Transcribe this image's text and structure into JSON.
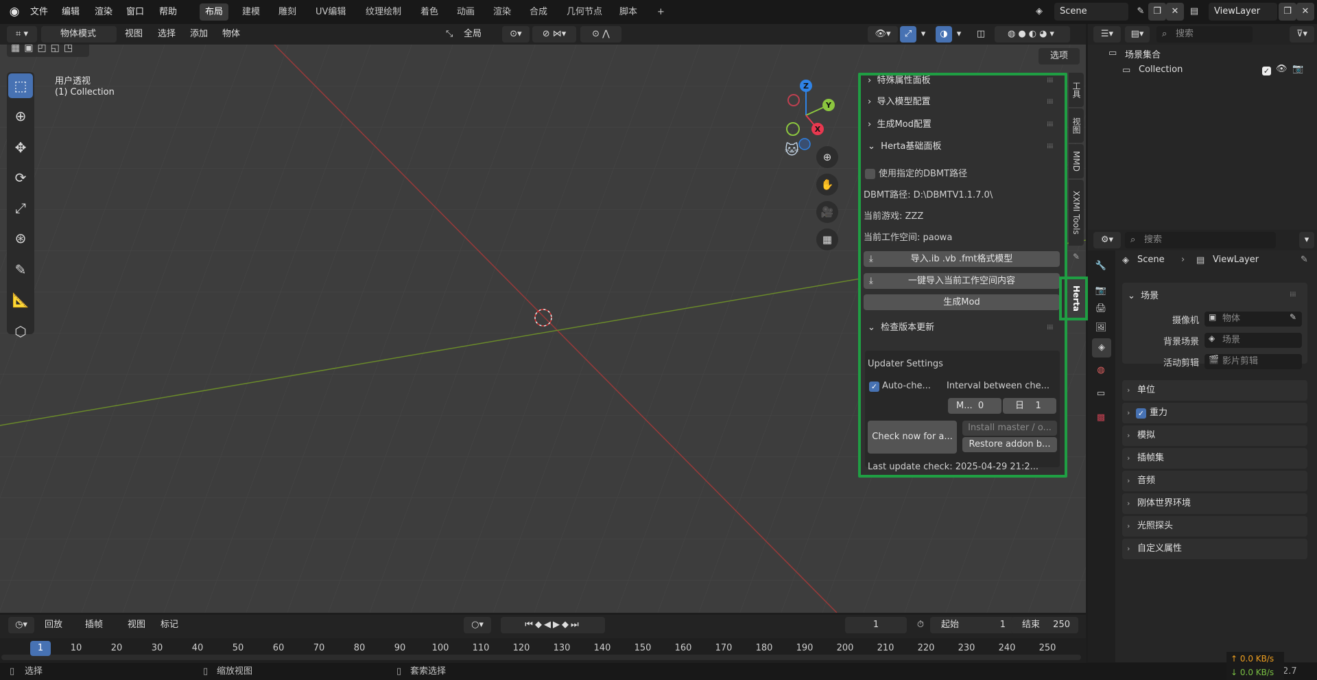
{
  "topbar": {
    "menus": [
      "文件",
      "编辑",
      "渲染",
      "窗口",
      "帮助"
    ],
    "workspaces": [
      "布局",
      "建模",
      "雕刻",
      "UV编辑",
      "纹理绘制",
      "着色",
      "动画",
      "渲染",
      "合成",
      "几何节点",
      "脚本"
    ],
    "add_workspace": "+",
    "scene_name": "Scene",
    "view_layer": "ViewLayer"
  },
  "viewport_header": {
    "mode": "物体模式",
    "menus": [
      "视图",
      "选择",
      "添加",
      "物体"
    ],
    "transform_orientation": "全局",
    "options": "选项"
  },
  "viewport": {
    "view_name": "用户透视",
    "collection_label": "(1) Collection",
    "gizmo": {
      "x": "X",
      "y": "Y",
      "z": "Z"
    }
  },
  "sidebar_tabs": [
    "工具",
    "视图",
    "MMD",
    "XXMI Tools",
    "Herta"
  ],
  "herta_panel": {
    "sections": [
      "特殊属性面板",
      "导入模型配置",
      "生成Mod配置",
      "Herta基础面板"
    ],
    "use_dbmt_label": "使用指定的DBMT路径",
    "dbmt_path": "DBMT路径: D:\\DBMTV1.1.7.0\\",
    "current_game": "当前游戏: ZZZ",
    "workspace": "当前工作空间: paowa",
    "import_button": "导入.ib .vb .fmt格式模型",
    "import_all_button": "一键导入当前工作空间内容",
    "generate_button": "生成Mod",
    "update_section": "检查版本更新",
    "updater_title": "Updater Settings",
    "auto_check": "Auto-che...",
    "interval_label": "Interval between che...",
    "months_label": "M...",
    "months_value": "0",
    "days_label": "日",
    "days_value": "1",
    "check_now": "Check now for a...",
    "install_master": "Install master / o...",
    "restore_addon": "Restore addon b...",
    "last_check": "Last update check: 2025-04-29 21:2..."
  },
  "outliner": {
    "search_placeholder": "搜索",
    "scene_collection": "场景集合",
    "collection": "Collection"
  },
  "properties": {
    "search_placeholder": "搜索",
    "breadcrumb_scene": "Scene",
    "breadcrumb_layer": "ViewLayer",
    "scene_section": "场景",
    "camera_label": "摄像机",
    "camera_value": "物体",
    "background_label": "背景场景",
    "background_value": "场景",
    "clip_label": "活动剪辑",
    "clip_value": "影片剪辑",
    "categories": [
      "单位",
      "重力",
      "模拟",
      "插帧集",
      "音频",
      "刚体世界环境",
      "光照探头",
      "自定义属性"
    ]
  },
  "timeline": {
    "menus": [
      "回放",
      "插帧",
      "视图",
      "标记"
    ],
    "current_frame": "1",
    "start_label": "起始",
    "start_value": "1",
    "end_label": "结束",
    "end_value": "250",
    "ticks": [
      "1",
      "10",
      "20",
      "30",
      "40",
      "50",
      "60",
      "70",
      "80",
      "90",
      "100",
      "110",
      "120",
      "130",
      "140",
      "150",
      "160",
      "170",
      "180",
      "190",
      "200",
      "210",
      "220",
      "230",
      "240",
      "250"
    ]
  },
  "statusbar": {
    "select": "选择",
    "zoom": "缩放视图",
    "lasso": "套索选择",
    "upload": "↑ 0.0 KB/s",
    "download": "↓ 0.0 KB/s",
    "version": "2.7"
  },
  "colors": {
    "accent": "#4772b3",
    "highlight": "#1f9e43",
    "x_axis": "#e8384f",
    "y_axis": "#8cc63f",
    "z_axis": "#2f83e6"
  }
}
